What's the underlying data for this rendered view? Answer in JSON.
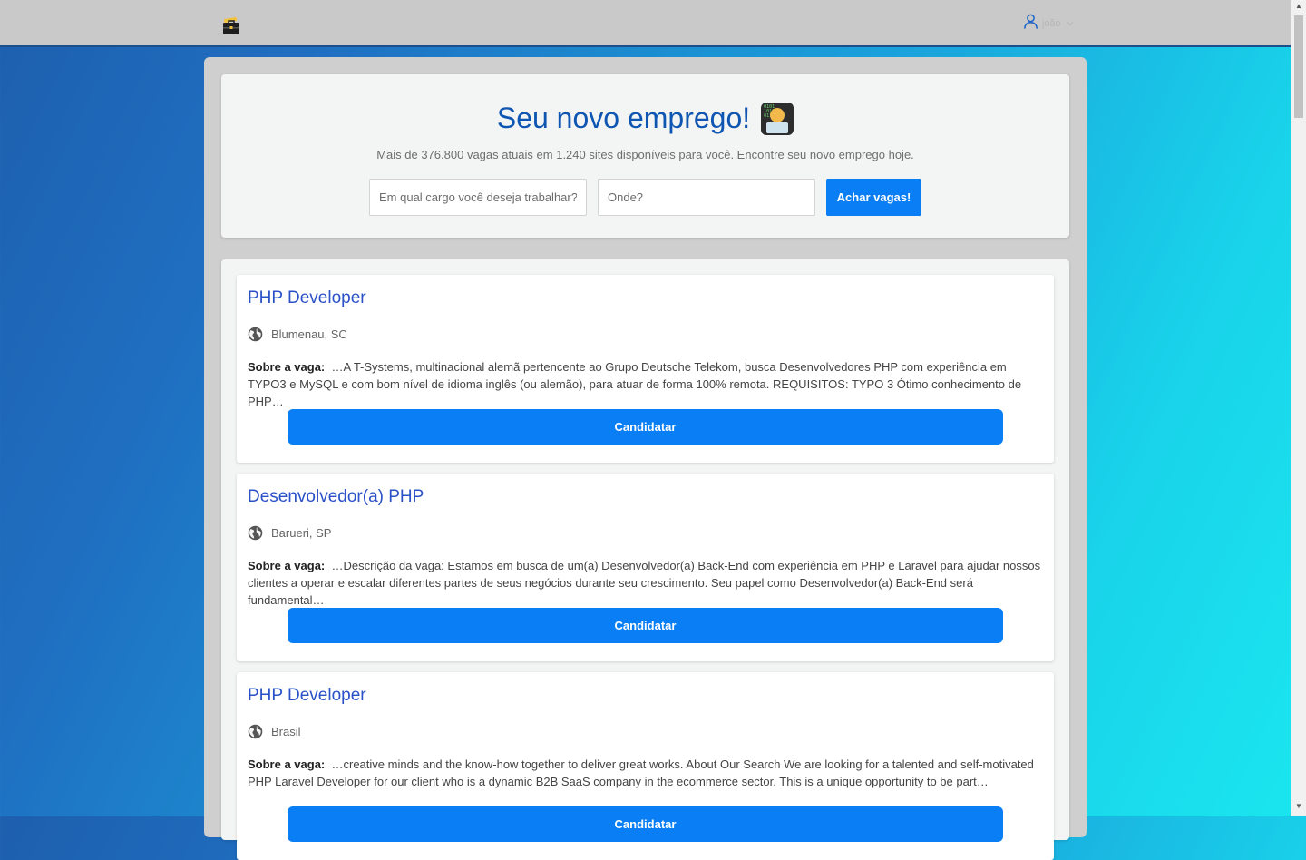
{
  "header": {
    "logo_icon": "briefcase-icon",
    "user_icon": "user-icon",
    "user_name": "joão",
    "chevron_icon": "chevron-down-icon"
  },
  "hero": {
    "title": "Seu novo emprego!",
    "emoji_icon": "technologist-emoji-icon",
    "subtitle": "Mais de 376.800 vagas atuais em 1.240 sites disponíveis para você. Encontre seu novo emprego hoje.",
    "job_placeholder": "Em qual cargo você deseja trabalhar?",
    "location_placeholder": "Onde?",
    "search_button": "Achar vagas!"
  },
  "jobs": [
    {
      "title": "PHP Developer",
      "location": "Blumenau, SC",
      "desc_label": "Sobre a vaga:",
      "description": "…A T-Systems, multinacional alemã pertencente ao Grupo Deutsche Telekom, busca Desenvolvedores PHP com experiência em TYPO3 e MySQL e com bom nível de idioma inglês (ou alemão), para atuar de forma 100% remota. REQUISITOS: TYPO 3 Ótimo conhecimento de PHP…",
      "apply": "Candidatar"
    },
    {
      "title": "Desenvolvedor(a) PHP",
      "location": "Barueri, SP",
      "desc_label": "Sobre a vaga:",
      "description": "…Descrição da vaga: Estamos em busca de um(a) Desenvolvedor(a) Back-End com experiência em PHP e Laravel para ajudar nossos clientes a operar e escalar diferentes partes de seus negócios durante seu crescimento. Seu papel como Desenvolvedor(a) Back-End será fundamental…",
      "apply": "Candidatar"
    },
    {
      "title": "PHP Developer",
      "location": "Brasil",
      "desc_label": "Sobre a vaga:",
      "description": "…creative minds and the know-how together to deliver great works. About Our Search We are looking for a talented and self-motivated PHP Laravel Developer for our client who is a dynamic B2B SaaS company in the ecommerce sector. This is a unique opportunity to be part…",
      "apply": "Candidatar"
    }
  ],
  "colors": {
    "accent": "#0a7ef4",
    "title_blue": "#0f56b3",
    "job_title": "#2a51c7"
  }
}
